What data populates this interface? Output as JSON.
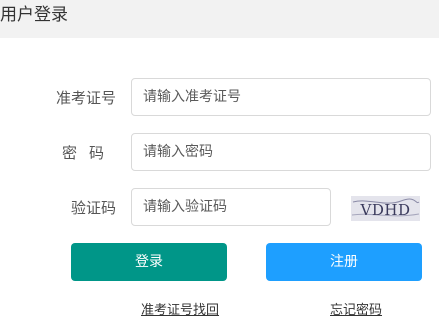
{
  "header": {
    "title": "用户登录"
  },
  "form": {
    "ticket": {
      "label": "准考证号",
      "value": "",
      "placeholder": "请输入准考证号"
    },
    "password": {
      "label": "密码",
      "value": "",
      "placeholder": "请输入密码"
    },
    "captcha": {
      "label": "验证码",
      "value": "",
      "placeholder": "请输入验证码",
      "image_text": "VDHD"
    }
  },
  "actions": {
    "login_label": "登录",
    "register_label": "注册"
  },
  "links": {
    "recover_ticket": "准考证号找回",
    "forgot_password": "忘记密码"
  },
  "colors": {
    "header_bg": "#f2f2f2",
    "login_button": "#009688",
    "register_button": "#1e9fff",
    "captcha_bg": "#e4e4ec"
  }
}
